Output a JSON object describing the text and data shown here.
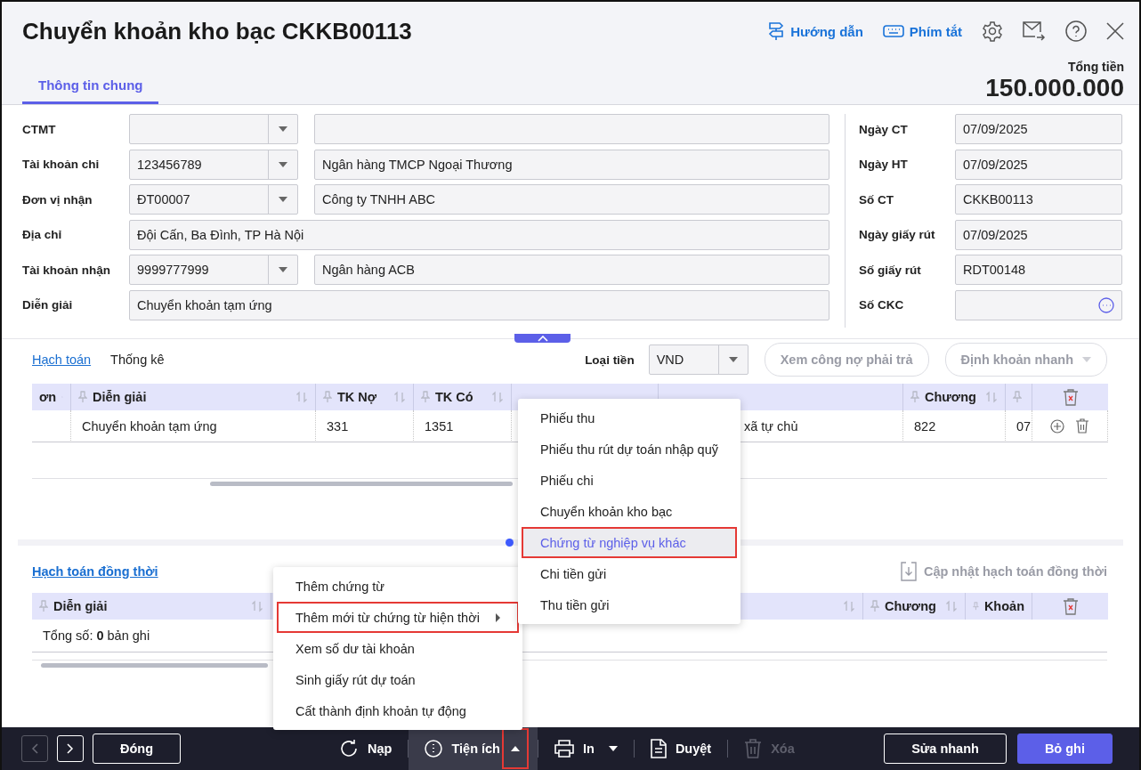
{
  "window": {
    "title": "Chuyển khoản kho bạc CKKB00113"
  },
  "header_actions": [
    {
      "kind": "guide",
      "label": "Hướng dẫn"
    },
    {
      "kind": "shortcuts",
      "label": "Phím tắt"
    },
    {
      "kind": "settings"
    },
    {
      "kind": "mail"
    },
    {
      "kind": "help"
    },
    {
      "kind": "close"
    }
  ],
  "tabs": [
    {
      "label": "Thông tin chung",
      "selected": true
    }
  ],
  "total": {
    "label": "Tổng tiền",
    "value": "150.000.000"
  },
  "form_left": [
    {
      "kind": "combo",
      "label": "CTMT"
    },
    {
      "kind": "combo",
      "label": "Tài khoản chi",
      "code": "123456789",
      "name": "Ngân hàng TMCP Ngoại Thương"
    },
    {
      "kind": "combo",
      "label": "Đơn vị nhận",
      "code": "ĐT00007",
      "name": "Công ty TNHH ABC"
    },
    {
      "kind": "text",
      "label": "Địa chỉ",
      "value": "Đội Cấn, Ba Đình, TP Hà Nội"
    },
    {
      "kind": "combo",
      "label": "Tài khoản nhận",
      "code": "9999777999",
      "name": "Ngân hàng ACB"
    },
    {
      "kind": "text",
      "label": "Diễn giải",
      "value": "Chuyển khoản tạm ứng"
    }
  ],
  "form_right": [
    {
      "kind": "text",
      "label": "Ngày CT",
      "value": "07/09/2025"
    },
    {
      "kind": "text",
      "label": "Ngày HT",
      "value": "07/09/2025"
    },
    {
      "kind": "text",
      "label": "Số CT",
      "value": "CKKB00113"
    },
    {
      "kind": "text",
      "label": "Ngày giấy rút",
      "value": "07/09/2025"
    },
    {
      "kind": "text",
      "label": "Số giấy rút",
      "value": "RDT00148"
    },
    {
      "kind": "lookup",
      "label": "Số CKC"
    }
  ],
  "detail": {
    "tabs": [
      {
        "label": "Hạch toán",
        "selected": true
      },
      {
        "label": "Thống kê",
        "selected": false
      }
    ],
    "currency": {
      "label": "Loại tiền",
      "value": "VND"
    },
    "buttons": [
      {
        "kind": "plain",
        "label": "Xem công nợ phải trả",
        "disabled": true
      },
      {
        "kind": "dropdown",
        "label": "Định khoản nhanh",
        "disabled": true
      }
    ],
    "columns": [
      {
        "kind": "label",
        "label": "ơn"
      },
      {
        "kind": "label",
        "label": "Diễn giải"
      },
      {
        "kind": "label",
        "label": "TK Nợ"
      },
      {
        "kind": "label",
        "label": "TK Có"
      },
      {
        "kind": "covered"
      },
      {
        "kind": "covered"
      },
      {
        "kind": "label",
        "label": "Chương"
      },
      {
        "kind": "cut"
      }
    ],
    "rows": [
      {
        "cells": [
          {},
          {
            "text": "Chuyển khoản tạm ứng"
          },
          {
            "text": "331"
          },
          {
            "text": "1351"
          },
          {},
          {
            "text": "xã tự chủ"
          },
          {
            "text": "822"
          },
          {
            "text": "07"
          }
        ]
      }
    ]
  },
  "concurrent": {
    "title": "Hạch toán đồng thời",
    "update_button": {
      "label": "Cập nhật hạch toán đồng thời",
      "disabled": true
    },
    "columns": [
      {
        "kind": "label",
        "label": "Diễn giải"
      },
      {
        "kind": "covered"
      },
      {
        "kind": "label",
        "label": "Chương"
      },
      {
        "kind": "label",
        "label": "Khoản"
      }
    ],
    "summary": "Tổng số: **0** bản ghi"
  },
  "footer": {
    "nav": [
      {
        "kind": "prev",
        "disabled": true
      },
      {
        "kind": "next",
        "disabled": false
      }
    ],
    "close_label": "Đóng",
    "actions": [
      {
        "kind": "reload",
        "label": "Nạp",
        "selected": false,
        "disabled": false
      },
      {
        "kind": "utilities",
        "label": "Tiện ích",
        "selected": true,
        "disabled": false,
        "caret_highlighted": true
      },
      {
        "kind": "print",
        "label": "In",
        "selected": false,
        "disabled": false
      },
      {
        "kind": "approve",
        "label": "Duyệt",
        "selected": false,
        "disabled": false
      },
      {
        "kind": "delete",
        "label": "Xóa",
        "selected": false,
        "disabled": true
      }
    ],
    "quick_edit": "Sửa nhanh",
    "unpost": "Bỏ ghi"
  },
  "utilities_menu": [
    {
      "label": "Thêm chứng từ",
      "has_submenu": false,
      "highlighted": false
    },
    {
      "label": "Thêm mới từ chứng từ hiện thời",
      "has_submenu": true,
      "highlighted": true
    },
    {
      "label": "Xem số dư tài khoản",
      "has_submenu": false,
      "highlighted": false
    },
    {
      "label": "Sinh giấy rút dự toán",
      "has_submenu": false,
      "highlighted": false
    },
    {
      "label": "Cất thành định khoản tự động",
      "has_submenu": false,
      "highlighted": false
    }
  ],
  "submenu": [
    {
      "label": "Phiếu thu",
      "selected": false,
      "highlighted": false
    },
    {
      "label": "Phiếu thu rút dự toán nhập quỹ",
      "selected": false,
      "highlighted": false
    },
    {
      "label": "Phiếu chi",
      "selected": false,
      "highlighted": false
    },
    {
      "label": "Chuyển khoản kho bạc",
      "selected": false,
      "highlighted": false
    },
    {
      "label": "Chứng từ nghiệp vụ khác",
      "selected": true,
      "highlighted": true
    },
    {
      "label": "Chi tiền gửi",
      "selected": false,
      "highlighted": false
    },
    {
      "label": "Thu tiền gửi",
      "selected": false,
      "highlighted": false
    }
  ]
}
